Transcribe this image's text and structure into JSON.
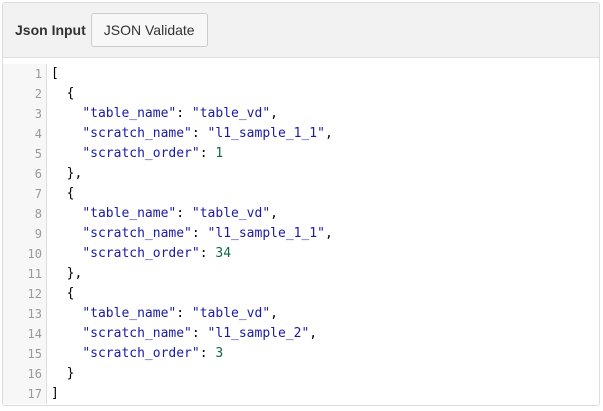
{
  "header": {
    "title": "Json Input",
    "validate_label": "JSON Validate"
  },
  "editor": {
    "lines": [
      [
        {
          "t": "[",
          "k": "punc"
        }
      ],
      [
        {
          "t": "  {",
          "k": "punc"
        }
      ],
      [
        {
          "t": "    ",
          "k": "punc"
        },
        {
          "t": "\"table_name\"",
          "k": "str"
        },
        {
          "t": ": ",
          "k": "punc"
        },
        {
          "t": "\"table_vd\"",
          "k": "str"
        },
        {
          "t": ",",
          "k": "punc"
        }
      ],
      [
        {
          "t": "    ",
          "k": "punc"
        },
        {
          "t": "\"scratch_name\"",
          "k": "str"
        },
        {
          "t": ": ",
          "k": "punc"
        },
        {
          "t": "\"l1_sample_1_1\"",
          "k": "str"
        },
        {
          "t": ",",
          "k": "punc"
        }
      ],
      [
        {
          "t": "    ",
          "k": "punc"
        },
        {
          "t": "\"scratch_order\"",
          "k": "str"
        },
        {
          "t": ": ",
          "k": "punc"
        },
        {
          "t": "1",
          "k": "num"
        }
      ],
      [
        {
          "t": "  },",
          "k": "punc"
        }
      ],
      [
        {
          "t": "  {",
          "k": "punc"
        }
      ],
      [
        {
          "t": "    ",
          "k": "punc"
        },
        {
          "t": "\"table_name\"",
          "k": "str"
        },
        {
          "t": ": ",
          "k": "punc"
        },
        {
          "t": "\"table_vd\"",
          "k": "str"
        },
        {
          "t": ",",
          "k": "punc"
        }
      ],
      [
        {
          "t": "    ",
          "k": "punc"
        },
        {
          "t": "\"scratch_name\"",
          "k": "str"
        },
        {
          "t": ": ",
          "k": "punc"
        },
        {
          "t": "\"l1_sample_1_1\"",
          "k": "str"
        },
        {
          "t": ",",
          "k": "punc"
        }
      ],
      [
        {
          "t": "    ",
          "k": "punc"
        },
        {
          "t": "\"scratch_order\"",
          "k": "str"
        },
        {
          "t": ": ",
          "k": "punc"
        },
        {
          "t": "34",
          "k": "num"
        }
      ],
      [
        {
          "t": "  },",
          "k": "punc"
        }
      ],
      [
        {
          "t": "  {",
          "k": "punc"
        }
      ],
      [
        {
          "t": "    ",
          "k": "punc"
        },
        {
          "t": "\"table_name\"",
          "k": "str"
        },
        {
          "t": ": ",
          "k": "punc"
        },
        {
          "t": "\"table_vd\"",
          "k": "str"
        },
        {
          "t": ",",
          "k": "punc"
        }
      ],
      [
        {
          "t": "    ",
          "k": "punc"
        },
        {
          "t": "\"scratch_name\"",
          "k": "str"
        },
        {
          "t": ": ",
          "k": "punc"
        },
        {
          "t": "\"l1_sample_2\"",
          "k": "str"
        },
        {
          "t": ",",
          "k": "punc"
        }
      ],
      [
        {
          "t": "    ",
          "k": "punc"
        },
        {
          "t": "\"scratch_order\"",
          "k": "str"
        },
        {
          "t": ": ",
          "k": "punc"
        },
        {
          "t": "3",
          "k": "num"
        }
      ],
      [
        {
          "t": "  }",
          "k": "punc"
        }
      ],
      [
        {
          "t": "]",
          "k": "punc"
        }
      ]
    ]
  }
}
